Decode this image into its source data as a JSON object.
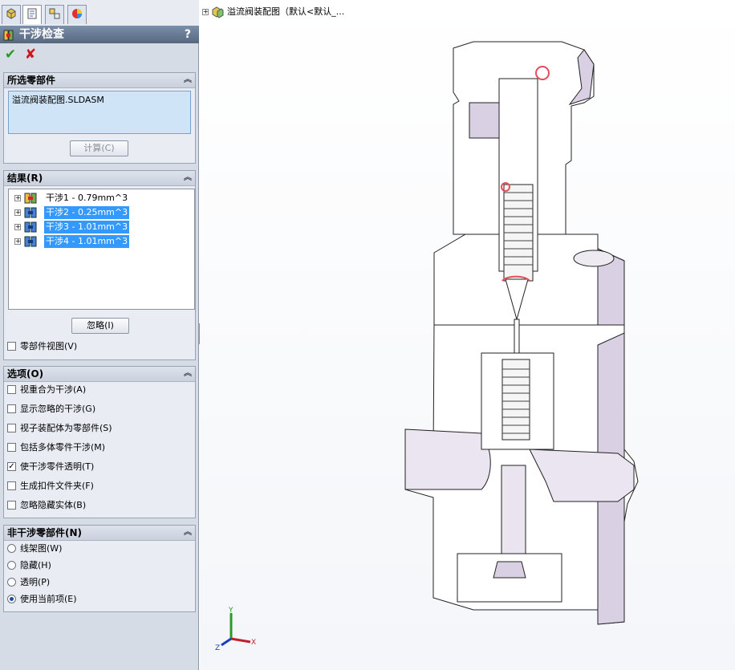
{
  "property_manager": {
    "title": "干涉检查",
    "help": "?",
    "selected_components": {
      "header": "所选零部件",
      "item": "溢流阀装配图.SLDASM",
      "calculate_label": "计算(C)"
    },
    "results": {
      "header": "结果(R)",
      "items": [
        {
          "label": "干涉1 - 0.79mm^3",
          "selected": false
        },
        {
          "label": "干涉2 - 0.25mm^3",
          "selected": true
        },
        {
          "label": "干涉3 - 1.01mm^3",
          "selected": true
        },
        {
          "label": "干涉4 - 1.01mm^3",
          "selected": true
        }
      ],
      "ignore_label": "忽略(I)",
      "component_view_label": "零部件视图(V)"
    },
    "options": {
      "header": "选项(O)",
      "items": [
        {
          "label": "视重合为干涉(A)",
          "checked": false
        },
        {
          "label": "显示忽略的干涉(G)",
          "checked": false
        },
        {
          "label": "视子装配体为零部件(S)",
          "checked": false
        },
        {
          "label": "包括多体零件干涉(M)",
          "checked": false
        },
        {
          "label": "使干涉零件透明(T)",
          "checked": true
        },
        {
          "label": "生成扣件文件夹(F)",
          "checked": false
        },
        {
          "label": "忽略隐藏实体(B)",
          "checked": false
        }
      ]
    },
    "non_interfering": {
      "header": "非干涉零部件(N)",
      "items": [
        {
          "label": "线架图(W)",
          "selected": false
        },
        {
          "label": "隐藏(H)",
          "selected": false
        },
        {
          "label": "透明(P)",
          "selected": false
        },
        {
          "label": "使用当前项(E)",
          "selected": true
        }
      ]
    }
  },
  "feature_tree": {
    "assembly_label": "溢流阀装配图（默认<默认_..."
  },
  "triad": {
    "x": "X",
    "y": "Y",
    "z": "Z"
  },
  "colors": {
    "accent": "#3399ff",
    "title_bar": "#55687f",
    "ok": "#2a9a27",
    "cancel": "#d2141c",
    "section_face": "#ffffff",
    "shade": "#d9d0e4"
  }
}
